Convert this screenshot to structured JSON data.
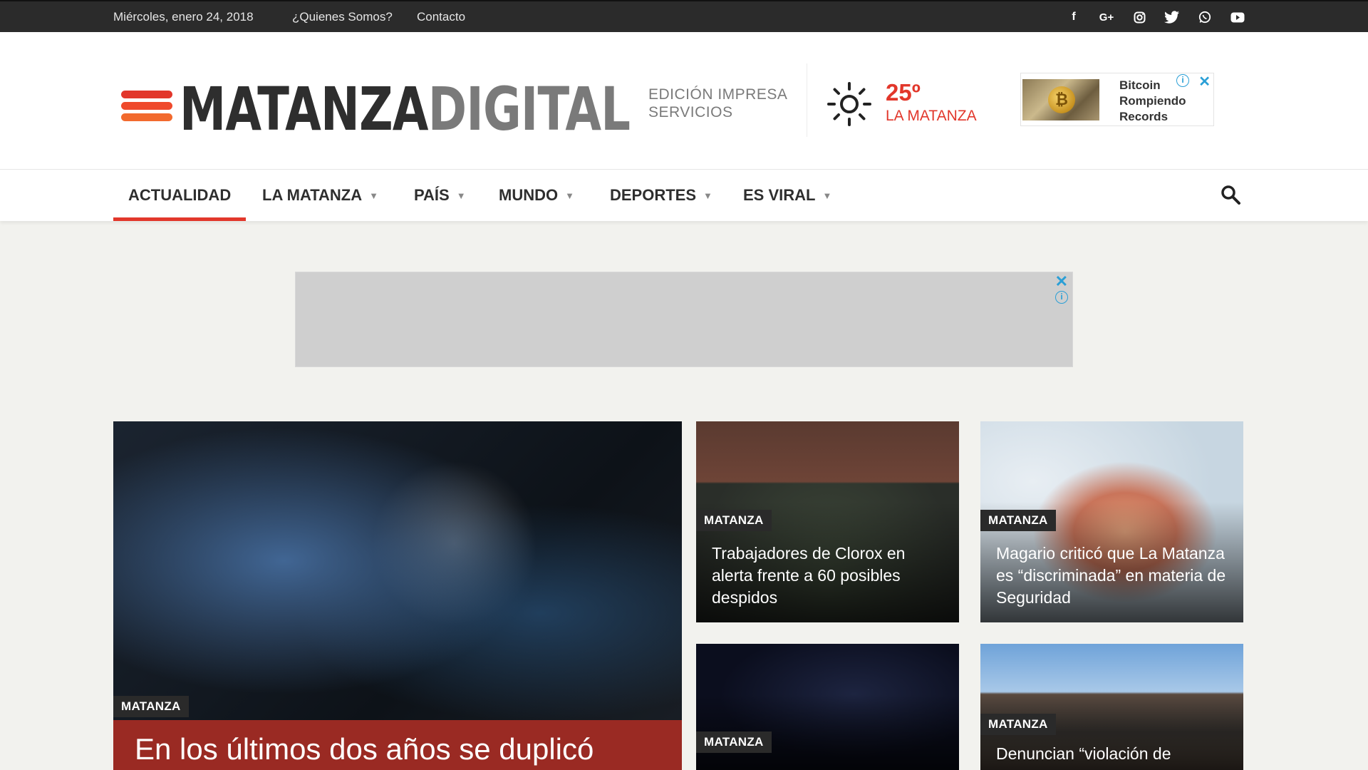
{
  "topbar": {
    "date": "Miércoles, enero 24, 2018",
    "links": [
      "¿Quienes Somos?",
      "Contacto"
    ],
    "social_icons": [
      "facebook-icon",
      "google-plus-icon",
      "instagram-icon",
      "twitter-icon",
      "whatsapp-icon",
      "youtube-icon"
    ]
  },
  "header": {
    "logo": {
      "part1": "MATANZA",
      "part2": "DIGITAL"
    },
    "edition": [
      "EDICIÓN IMPRESA",
      "SERVICIOS"
    ],
    "weather": {
      "temp": "25º",
      "location": "LA MATANZA",
      "icon": "sun-icon"
    },
    "ad": {
      "text": [
        "Bitcoin",
        "Rompiendo",
        "Records"
      ]
    }
  },
  "nav": {
    "items": [
      {
        "label": "ACTUALIDAD",
        "dropdown": false,
        "active": true
      },
      {
        "label": "LA MATANZA",
        "dropdown": true
      },
      {
        "label": "PAÍS",
        "dropdown": true
      },
      {
        "label": "MUNDO",
        "dropdown": true
      },
      {
        "label": "DEPORTES",
        "dropdown": true
      },
      {
        "label": "ES VIRAL",
        "dropdown": true
      }
    ]
  },
  "articles": {
    "main": {
      "tag": "MATANZA",
      "title": "En los últimos dos años se duplicó"
    },
    "a": {
      "tag": "MATANZA",
      "title": "Trabajadores de Clorox en alerta frente a 60 posibles despidos"
    },
    "b": {
      "tag": "MATANZA",
      "title": "Magario criticó que La Matanza es “discriminada” en materia de Seguridad"
    },
    "c": {
      "tag": "MATANZA",
      "title": ""
    },
    "d": {
      "tag": "MATANZA",
      "title": "Denuncian “violación de"
    }
  },
  "colors": {
    "accent": "#e2372b",
    "topbar": "#2b2b2b",
    "ad_blue": "#2a9fd6"
  }
}
